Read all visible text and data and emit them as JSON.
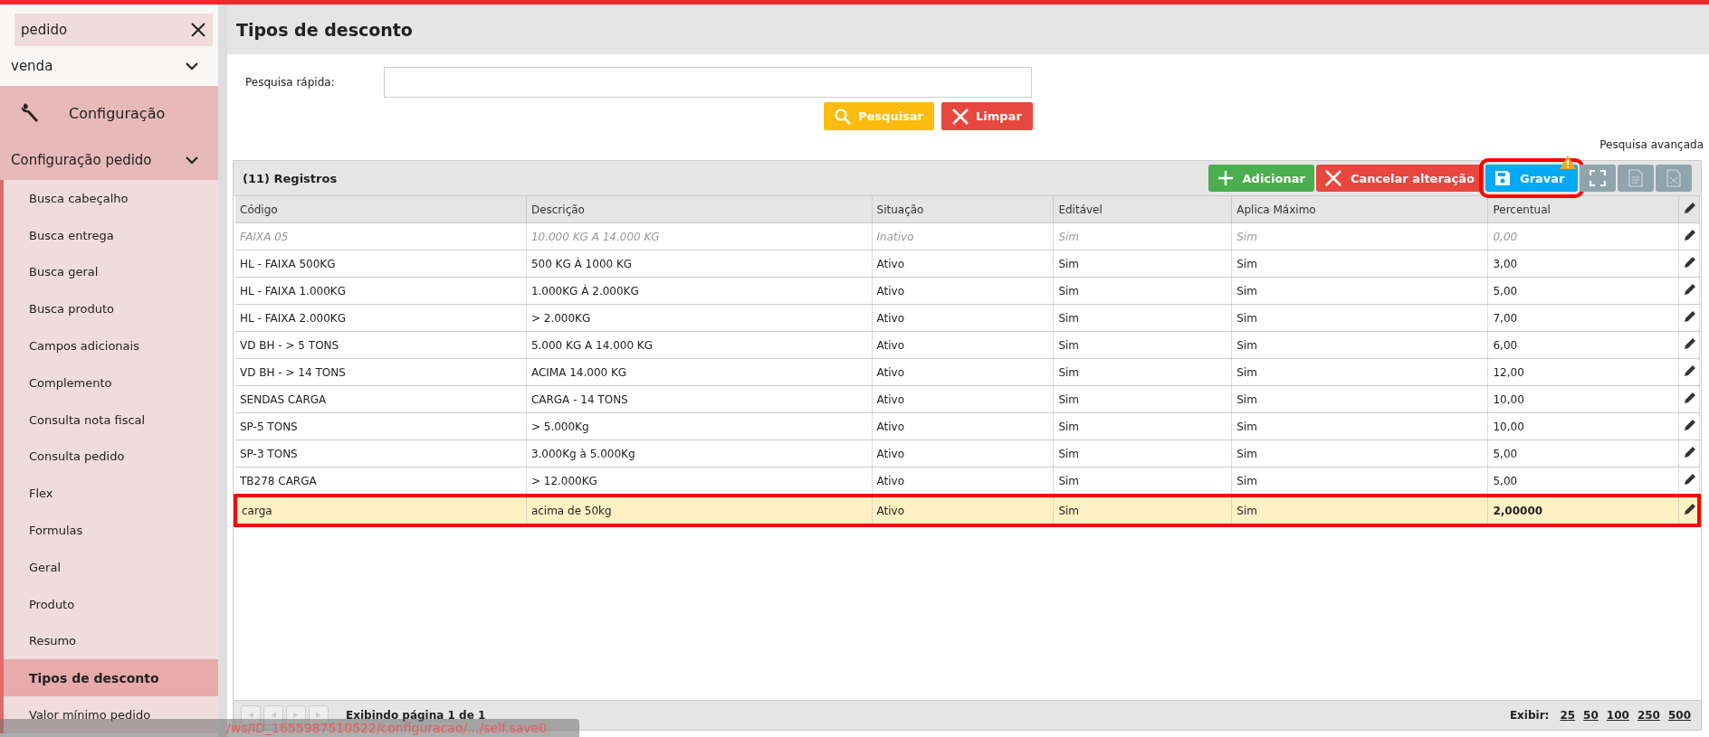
{
  "sidebar": {
    "search": {
      "value": "pedido"
    },
    "sections": [
      {
        "label": "venda",
        "kind": "collapsible"
      },
      {
        "label": "Configuração",
        "kind": "module"
      },
      {
        "label": "Configuração pedido",
        "kind": "collapsible"
      }
    ],
    "items": [
      {
        "label": "Busca cabeçalho",
        "selected": false
      },
      {
        "label": "Busca entrega",
        "selected": false
      },
      {
        "label": "Busca geral",
        "selected": false
      },
      {
        "label": "Busca produto",
        "selected": false
      },
      {
        "label": "Campos adicionais",
        "selected": false
      },
      {
        "label": "Complemento",
        "selected": false
      },
      {
        "label": "Consulta nota fiscal",
        "selected": false
      },
      {
        "label": "Consulta pedido",
        "selected": false
      },
      {
        "label": "Flex",
        "selected": false
      },
      {
        "label": "Formulas",
        "selected": false
      },
      {
        "label": "Geral",
        "selected": false
      },
      {
        "label": "Produto",
        "selected": false
      },
      {
        "label": "Resumo",
        "selected": false
      },
      {
        "label": "Tipos de desconto",
        "selected": true
      },
      {
        "label": "Valor mínimo pedido",
        "selected": false
      }
    ]
  },
  "page_title": "Tipos de desconto",
  "quick_search": {
    "label": "Pesquisa rápida:",
    "search_button": "Pesquisar",
    "clear_button": "Limpar",
    "advanced_link": "Pesquisa avançada"
  },
  "grid": {
    "record_count": "(11) Registros",
    "toolbar": [
      {
        "label": "Adicionar",
        "kind": "add"
      },
      {
        "label": "Cancelar alteração",
        "kind": "cancel"
      },
      {
        "label": "Gravar",
        "kind": "save",
        "warning": true,
        "outlined": true
      },
      {
        "kind": "fullscreen"
      },
      {
        "kind": "csv"
      },
      {
        "kind": "xls"
      }
    ],
    "columns": [
      "Código",
      "Descrição",
      "Situação",
      "Editável",
      "Aplica Máximo",
      "Percentual"
    ],
    "rows": [
      {
        "cells": [
          "FAIXA 05",
          "10.000 KG A 14.000 KG",
          "Inativo",
          "Sim",
          "Sim",
          "0,00"
        ],
        "disabled": true,
        "edited": false
      },
      {
        "cells": [
          "HL - FAIXA 500KG",
          "500 KG À 1000 KG",
          "Ativo",
          "Sim",
          "Sim",
          "3,00"
        ],
        "disabled": false,
        "edited": false
      },
      {
        "cells": [
          "HL - FAIXA 1.000KG",
          "1.000KG À 2.000KG",
          "Ativo",
          "Sim",
          "Sim",
          "5,00"
        ],
        "disabled": false,
        "edited": false
      },
      {
        "cells": [
          "HL - FAIXA 2.000KG",
          "> 2.000KG",
          "Ativo",
          "Sim",
          "Sim",
          "7,00"
        ],
        "disabled": false,
        "edited": false
      },
      {
        "cells": [
          "VD BH - > 5 TONS",
          "5.000 KG A 14.000 KG",
          "Ativo",
          "Sim",
          "Sim",
          "6,00"
        ],
        "disabled": false,
        "edited": false
      },
      {
        "cells": [
          "VD BH - > 14 TONS",
          "ACIMA 14.000 KG",
          "Ativo",
          "Sim",
          "Sim",
          "12,00"
        ],
        "disabled": false,
        "edited": false
      },
      {
        "cells": [
          "SENDAS CARGA",
          "CARGA - 14 TONS",
          "Ativo",
          "Sim",
          "Sim",
          "10,00"
        ],
        "disabled": false,
        "edited": false
      },
      {
        "cells": [
          "SP-5 TONS",
          "> 5.000Kg",
          "Ativo",
          "Sim",
          "Sim",
          "10,00"
        ],
        "disabled": false,
        "edited": false
      },
      {
        "cells": [
          "SP-3 TONS",
          "3.000Kg à 5.000Kg",
          "Ativo",
          "Sim",
          "Sim",
          "5,00"
        ],
        "disabled": false,
        "edited": false
      },
      {
        "cells": [
          "TB278 CARGA",
          "> 12.000KG",
          "Ativo",
          "Sim",
          "Sim",
          "5,00"
        ],
        "disabled": false,
        "edited": false
      },
      {
        "cells": [
          "carga",
          "acima de 50kg",
          "Ativo",
          "Sim",
          "Sim",
          "2,00000"
        ],
        "disabled": false,
        "edited": true
      }
    ],
    "pager": {
      "info": "Exibindo página 1 de 1",
      "show_label": "Exibir:",
      "sizes": [
        "25",
        "50",
        "100",
        "250",
        "500"
      ]
    }
  },
  "status_url": "/ws/ID_1655987510522/configuracao/.../self.save0"
}
